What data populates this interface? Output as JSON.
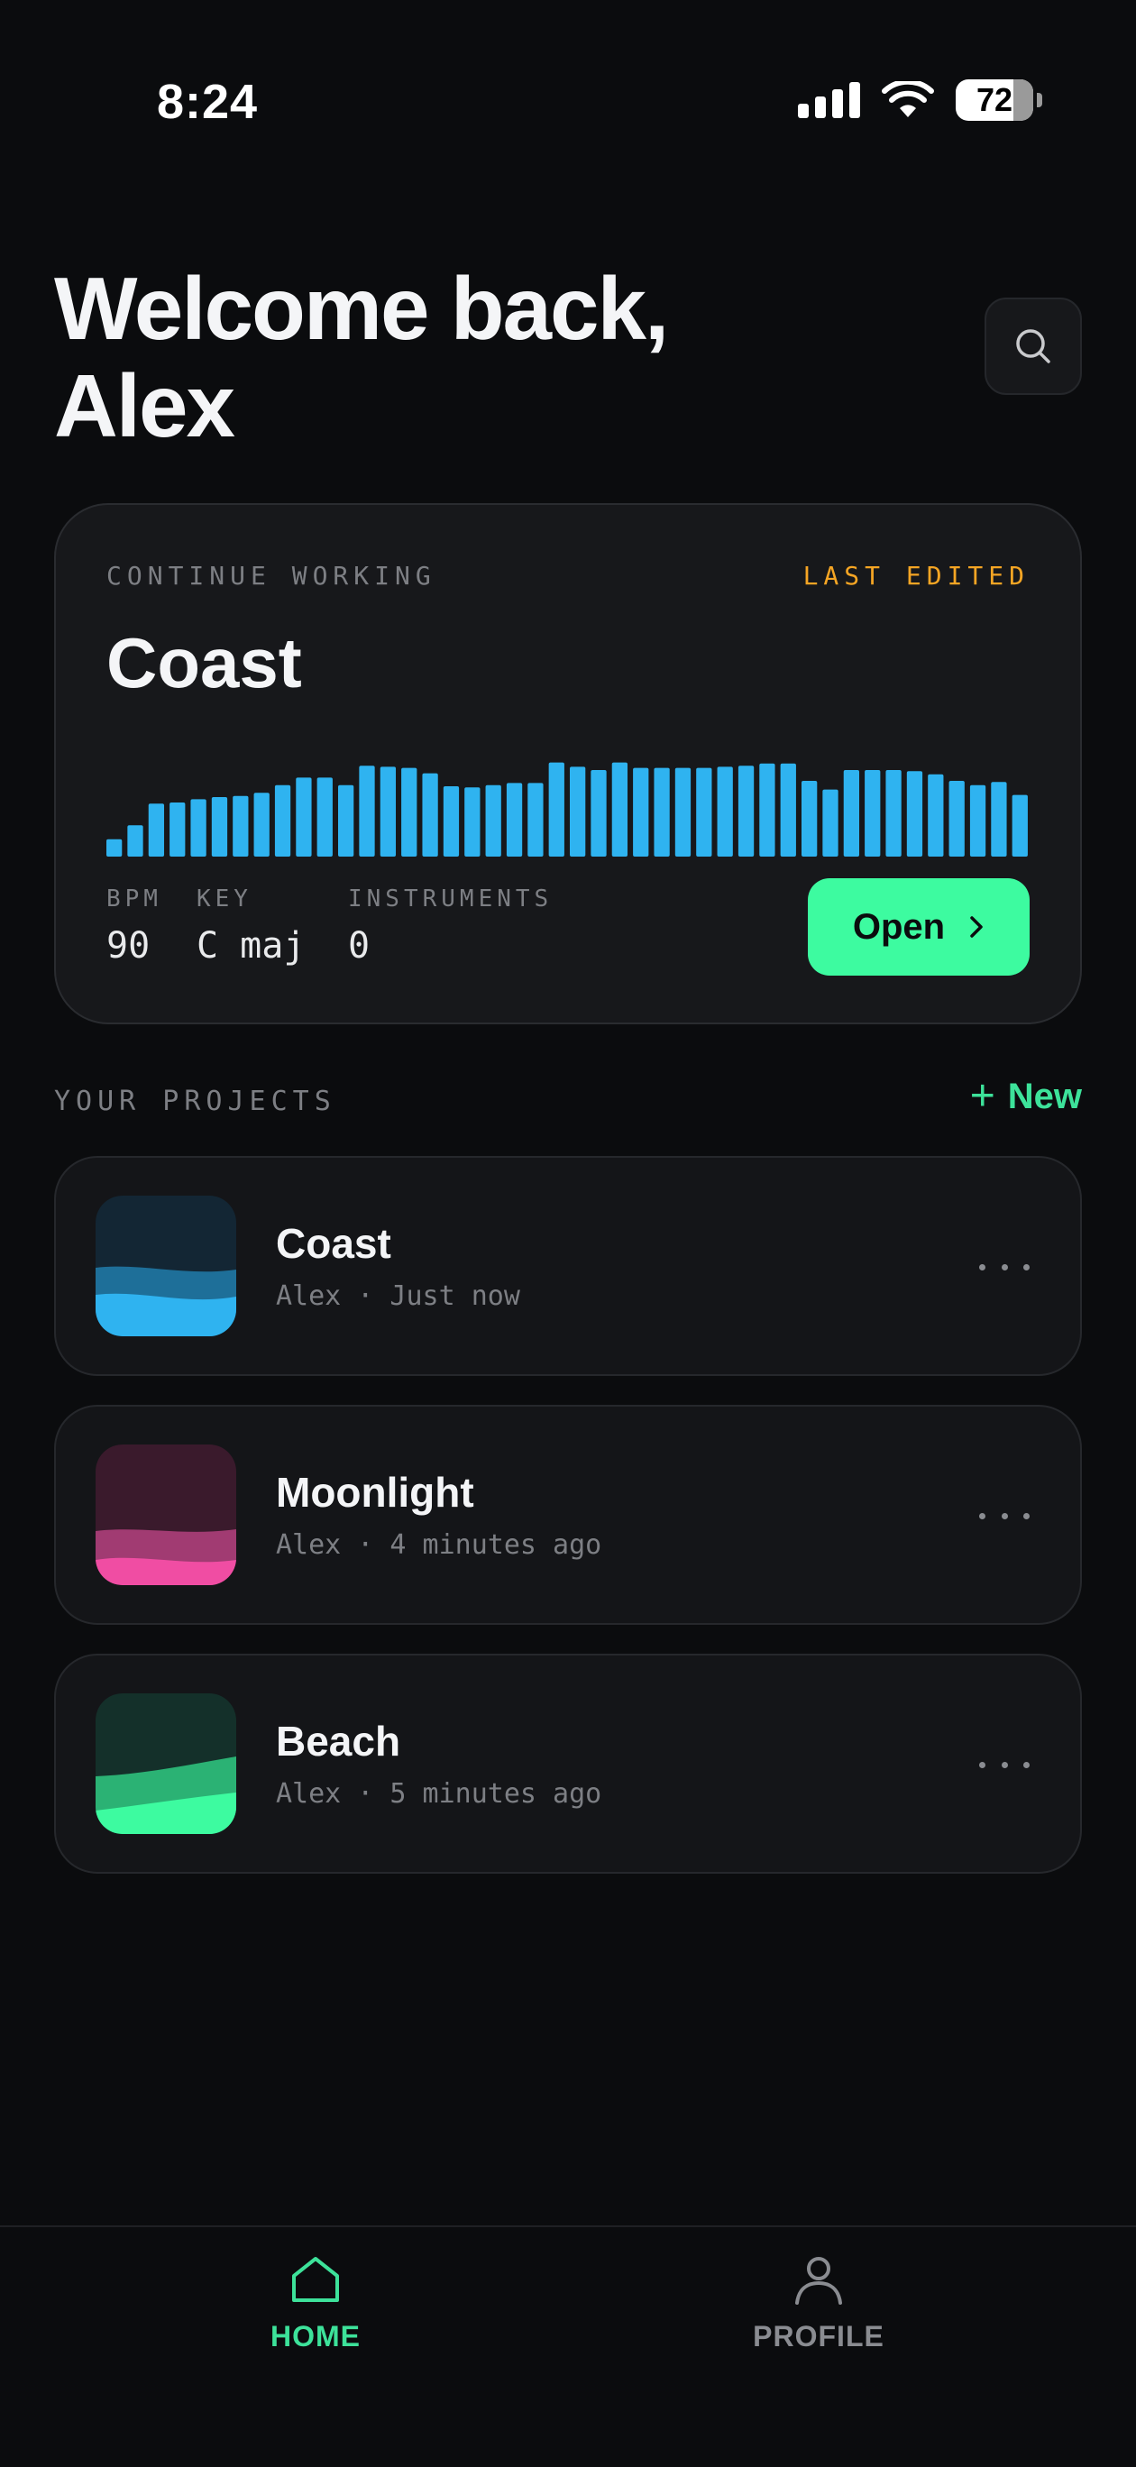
{
  "status_bar": {
    "time": "8:24",
    "battery": "72"
  },
  "header": {
    "welcome_line1": "Welcome back,",
    "welcome_line2": "Alex"
  },
  "continue_card": {
    "eyebrow": "CONTINUE WORKING",
    "badge": "LAST EDITED",
    "title": "Coast",
    "waveform_levels": [
      0.16,
      0.29,
      0.49,
      0.5,
      0.53,
      0.55,
      0.56,
      0.59,
      0.66,
      0.73,
      0.73,
      0.66,
      0.84,
      0.83,
      0.82,
      0.77,
      0.65,
      0.64,
      0.66,
      0.68,
      0.68,
      0.87,
      0.83,
      0.8,
      0.87,
      0.82,
      0.82,
      0.82,
      0.82,
      0.83,
      0.84,
      0.86,
      0.86,
      0.7,
      0.62,
      0.8,
      0.8,
      0.8,
      0.79,
      0.76,
      0.7,
      0.66,
      0.69,
      0.57
    ],
    "waveform_color": "#2fb3f0",
    "meta": [
      {
        "label": "BPM",
        "value": "90"
      },
      {
        "label": "KEY",
        "value": "C maj"
      },
      {
        "label": "INSTRUMENTS",
        "value": "0"
      }
    ],
    "open_label": "Open"
  },
  "projects_section": {
    "label": "YOUR PROJECTS",
    "new_label": "New"
  },
  "projects": [
    {
      "title": "Coast",
      "subtitle": "Alex · Just now",
      "colors": [
        "#132634",
        "#1e6f99",
        "#2fb3f0"
      ]
    },
    {
      "title": "Moonlight",
      "subtitle": "Alex · 4 minutes ago",
      "colors": [
        "#3a1a2c",
        "#a13b72",
        "#f04da3"
      ]
    },
    {
      "title": "Beach",
      "subtitle": "Alex · 5 minutes ago",
      "colors": [
        "#14302a",
        "#2bb274",
        "#3dfba0"
      ]
    }
  ],
  "nav": {
    "home_label": "HOME",
    "profile_label": "PROFILE",
    "accent": "#3de29a"
  }
}
